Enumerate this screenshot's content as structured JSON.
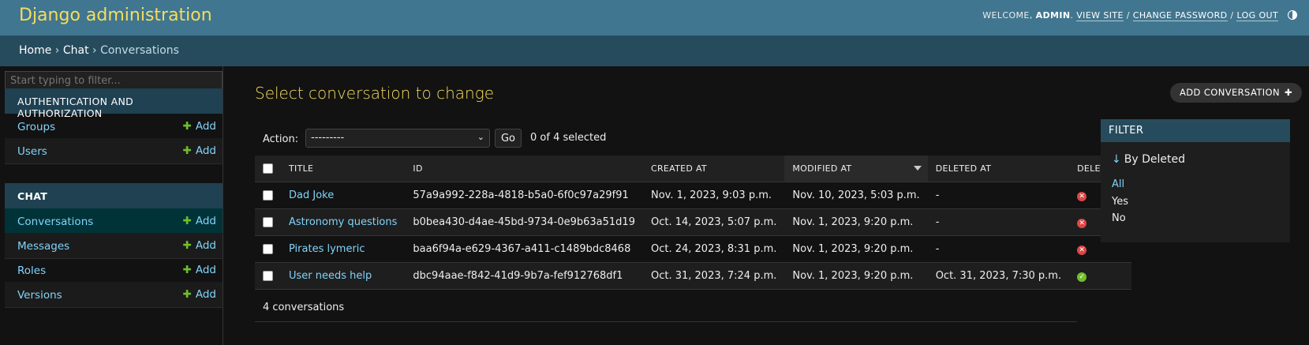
{
  "header": {
    "branding": "Django administration",
    "welcome": "Welcome,",
    "user": "admin",
    "view_site": "View site",
    "change_password": "Change password",
    "log_out": "Log out"
  },
  "breadcrumbs": {
    "home": "Home",
    "app": "Chat",
    "current": "Conversations",
    "separator": "›"
  },
  "sidebar": {
    "filter_placeholder": "Start typing to filter...",
    "modules": [
      {
        "caption": "Authentication and Authorization",
        "models": [
          {
            "name": "Groups",
            "add": "Add"
          },
          {
            "name": "Users",
            "add": "Add"
          }
        ]
      },
      {
        "caption": "Chat",
        "models": [
          {
            "name": "Conversations",
            "add": "Add"
          },
          {
            "name": "Messages",
            "add": "Add"
          },
          {
            "name": "Roles",
            "add": "Add"
          },
          {
            "name": "Versions",
            "add": "Add"
          }
        ]
      }
    ]
  },
  "main": {
    "title": "Select conversation to change",
    "add_button": "Add conversation",
    "actions": {
      "label": "Action:",
      "select_value": "---------",
      "go": "Go",
      "selected": "0 of 4 selected"
    },
    "table": {
      "columns": [
        "Title",
        "ID",
        "Created at",
        "Modified at",
        "Deleted at",
        "Deleted?"
      ],
      "rows": [
        {
          "title": "Dad Joke",
          "id": "57a9a992-228a-4818-b5a0-6f0c97a29f91",
          "created": "Nov. 1, 2023, 9:03 p.m.",
          "modified": "Nov. 10, 2023, 5:03 p.m.",
          "deleted_at": "-",
          "deleted": false
        },
        {
          "title": "Astronomy questions",
          "id": "b0bea430-d4ae-45bd-9734-0e9b63a51d19",
          "created": "Oct. 14, 2023, 5:07 p.m.",
          "modified": "Nov. 1, 2023, 9:20 p.m.",
          "deleted_at": "-",
          "deleted": false
        },
        {
          "title": "Pirates lymeric",
          "id": "baa6f94a-e629-4367-a411-c1489bdc8468",
          "created": "Oct. 24, 2023, 8:31 p.m.",
          "modified": "Nov. 1, 2023, 9:20 p.m.",
          "deleted_at": "-",
          "deleted": false
        },
        {
          "title": "User needs help",
          "id": "dbc94aae-f842-41d9-9b7a-fef912768df1",
          "created": "Oct. 31, 2023, 7:24 p.m.",
          "modified": "Nov. 1, 2023, 9:20 p.m.",
          "deleted_at": "Oct. 31, 2023, 7:30 p.m.",
          "deleted": true
        }
      ]
    },
    "paginator": "4 conversations"
  },
  "filter": {
    "title": "Filter",
    "heading": "By Deleted",
    "options": [
      "All",
      "Yes",
      "No"
    ]
  },
  "colors": {
    "header": "#417690",
    "breadcrumb": "#264b5d",
    "link": "#81d4fa",
    "brand": "#f5dd5d",
    "add_plus": "#70bf2b",
    "false_icon": "#dd4646",
    "true_icon": "#70bf2b"
  }
}
